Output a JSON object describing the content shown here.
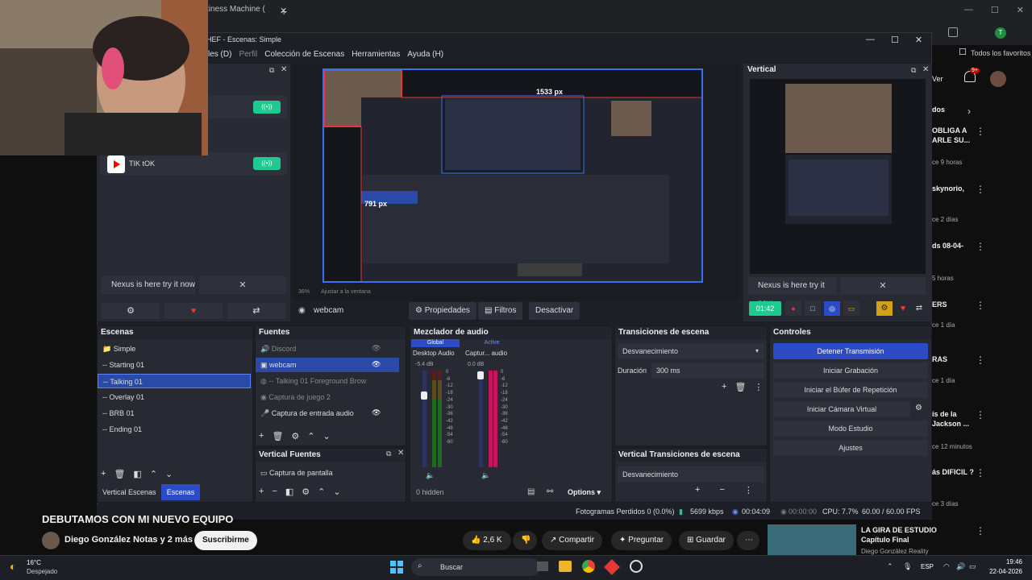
{
  "browser": {
    "tab_title": "tiness Machine (",
    "tab_close": "✕",
    "new_tab": "+",
    "bookmarks_label": "Todos los favoritos",
    "window_controls": [
      "—",
      "☐",
      "✕"
    ]
  },
  "youtube_sidebar": [
    {
      "title": "Ver",
      "meta": ""
    },
    {
      "title": "dos",
      "meta": ""
    },
    {
      "title": "OBLIGA A ARLE SU...",
      "meta": "ce 9 horas"
    },
    {
      "title": "skynorio,",
      "meta": "ce 2 días"
    },
    {
      "title": "ds 08-04-",
      "meta": "5 horas"
    },
    {
      "title": "ERS",
      "meta": "ce 1 día"
    },
    {
      "title": "RAS",
      "meta": "ce 1 día"
    },
    {
      "title": "ís de la Jackson ...",
      "meta": "ce 12 minutos"
    },
    {
      "title": "ás DIFICIL ?",
      "meta": "ce 3 días"
    }
  ],
  "notif_count": "9+",
  "obs": {
    "window_title": "HEF - Escenas: Simple",
    "menu": [
      "les (D)",
      "Perfil",
      "Colección de Escenas",
      "Herramientas",
      "Ayuda (H)"
    ],
    "dock_card_label": "TIK tOK",
    "nexus_text": "Nexus is here try it now",
    "nexus_close": "✕",
    "preview_size_label": "1533 px",
    "preview_size_label2": "791 px",
    "zoom": "36%",
    "zoom_fit": "Ajustar a la ventana",
    "vertical_title": "Vertical",
    "vertical_timer": "01:42",
    "source_toolbar": {
      "selected_source": "webcam",
      "properties": "Propiedades",
      "filters": "Filtros",
      "deactivate": "Desactivar"
    },
    "scenes": {
      "title": "Escenas",
      "items": [
        "Simple",
        "-- Starting 01",
        "-- Talking 01",
        "-- Overlay 01",
        "-- BRB 01",
        "-- Ending 01"
      ],
      "selected_index": 2,
      "tabs": [
        "Vertical Escenas",
        "Escenas"
      ]
    },
    "sources": {
      "title": "Fuentes",
      "items": [
        {
          "name": "Discord",
          "dim": true
        },
        {
          "name": "webcam",
          "dim": false
        },
        {
          "name": "-- Talking 01  Foreground Brow",
          "dim": true
        },
        {
          "name": "Captura de juego 2",
          "dim": true
        },
        {
          "name": "Captura de entrada audio",
          "dim": false
        }
      ]
    },
    "vertical_sources": {
      "title": "Vertical Fuentes",
      "items": [
        "Captura de pantalla"
      ]
    },
    "mixer": {
      "title": "Mezclador de audio",
      "tabs": [
        "Global",
        "Active"
      ],
      "channels": [
        {
          "name": "Desktop Audio",
          "db": "-5.4 dB"
        },
        {
          "name": "Captur... audio",
          "db": "0.0 dB"
        }
      ],
      "scale": [
        "0",
        "-6",
        "-12",
        "-18",
        "-24",
        "-30",
        "-36",
        "-42",
        "-48",
        "-54",
        "-60"
      ],
      "hidden_label": "0 hidden",
      "options": "Options"
    },
    "transitions": {
      "title": "Transiciones de escena",
      "type": "Desvanecimiento",
      "duration_label": "Duración",
      "duration_value": "300 ms"
    },
    "vertical_transitions": {
      "title": "Vertical Transiciones de escena",
      "type": "Desvanecimiento"
    },
    "controls": {
      "title": "Controles",
      "buttons": [
        "Detener Transmisión",
        "Iniciar Grabación",
        "Iniciar el Búfer de Repetición",
        "Iniciar Cámara Virtual",
        "Modo Estudio",
        "Ajustes"
      ]
    },
    "status": {
      "dropped": "Fotogramas Perdidos 0 (0.0%)",
      "bitrate": "5699 kbps",
      "stream_time": "00:04:09",
      "rec_time": "00:00:00",
      "cpu": "CPU: 7.7%",
      "fps": "60.00 / 60.00 FPS"
    }
  },
  "video": {
    "title": "DEBUTAMOS CON MI NUEVO EQUIPO",
    "channel": "Diego González Notas y 2 más",
    "subscribe": "Suscribirme",
    "likes": "2,6 K",
    "share": "Compartir",
    "ask": "Preguntar",
    "save": "Guardar",
    "next_title": "LA GIRA DE ESTUDIO Capítulo Final",
    "next_channel": "Diego González Reality"
  },
  "taskbar": {
    "temp": "16°C",
    "weather": "Despejado",
    "search": "Buscar",
    "lang": "ESP",
    "time": "19:46",
    "date": "22-04-2026"
  },
  "colors": {
    "accent_blue": "#2c4bc7",
    "live_green": "#1fc98f",
    "obs_bg": "#1d1f26"
  }
}
